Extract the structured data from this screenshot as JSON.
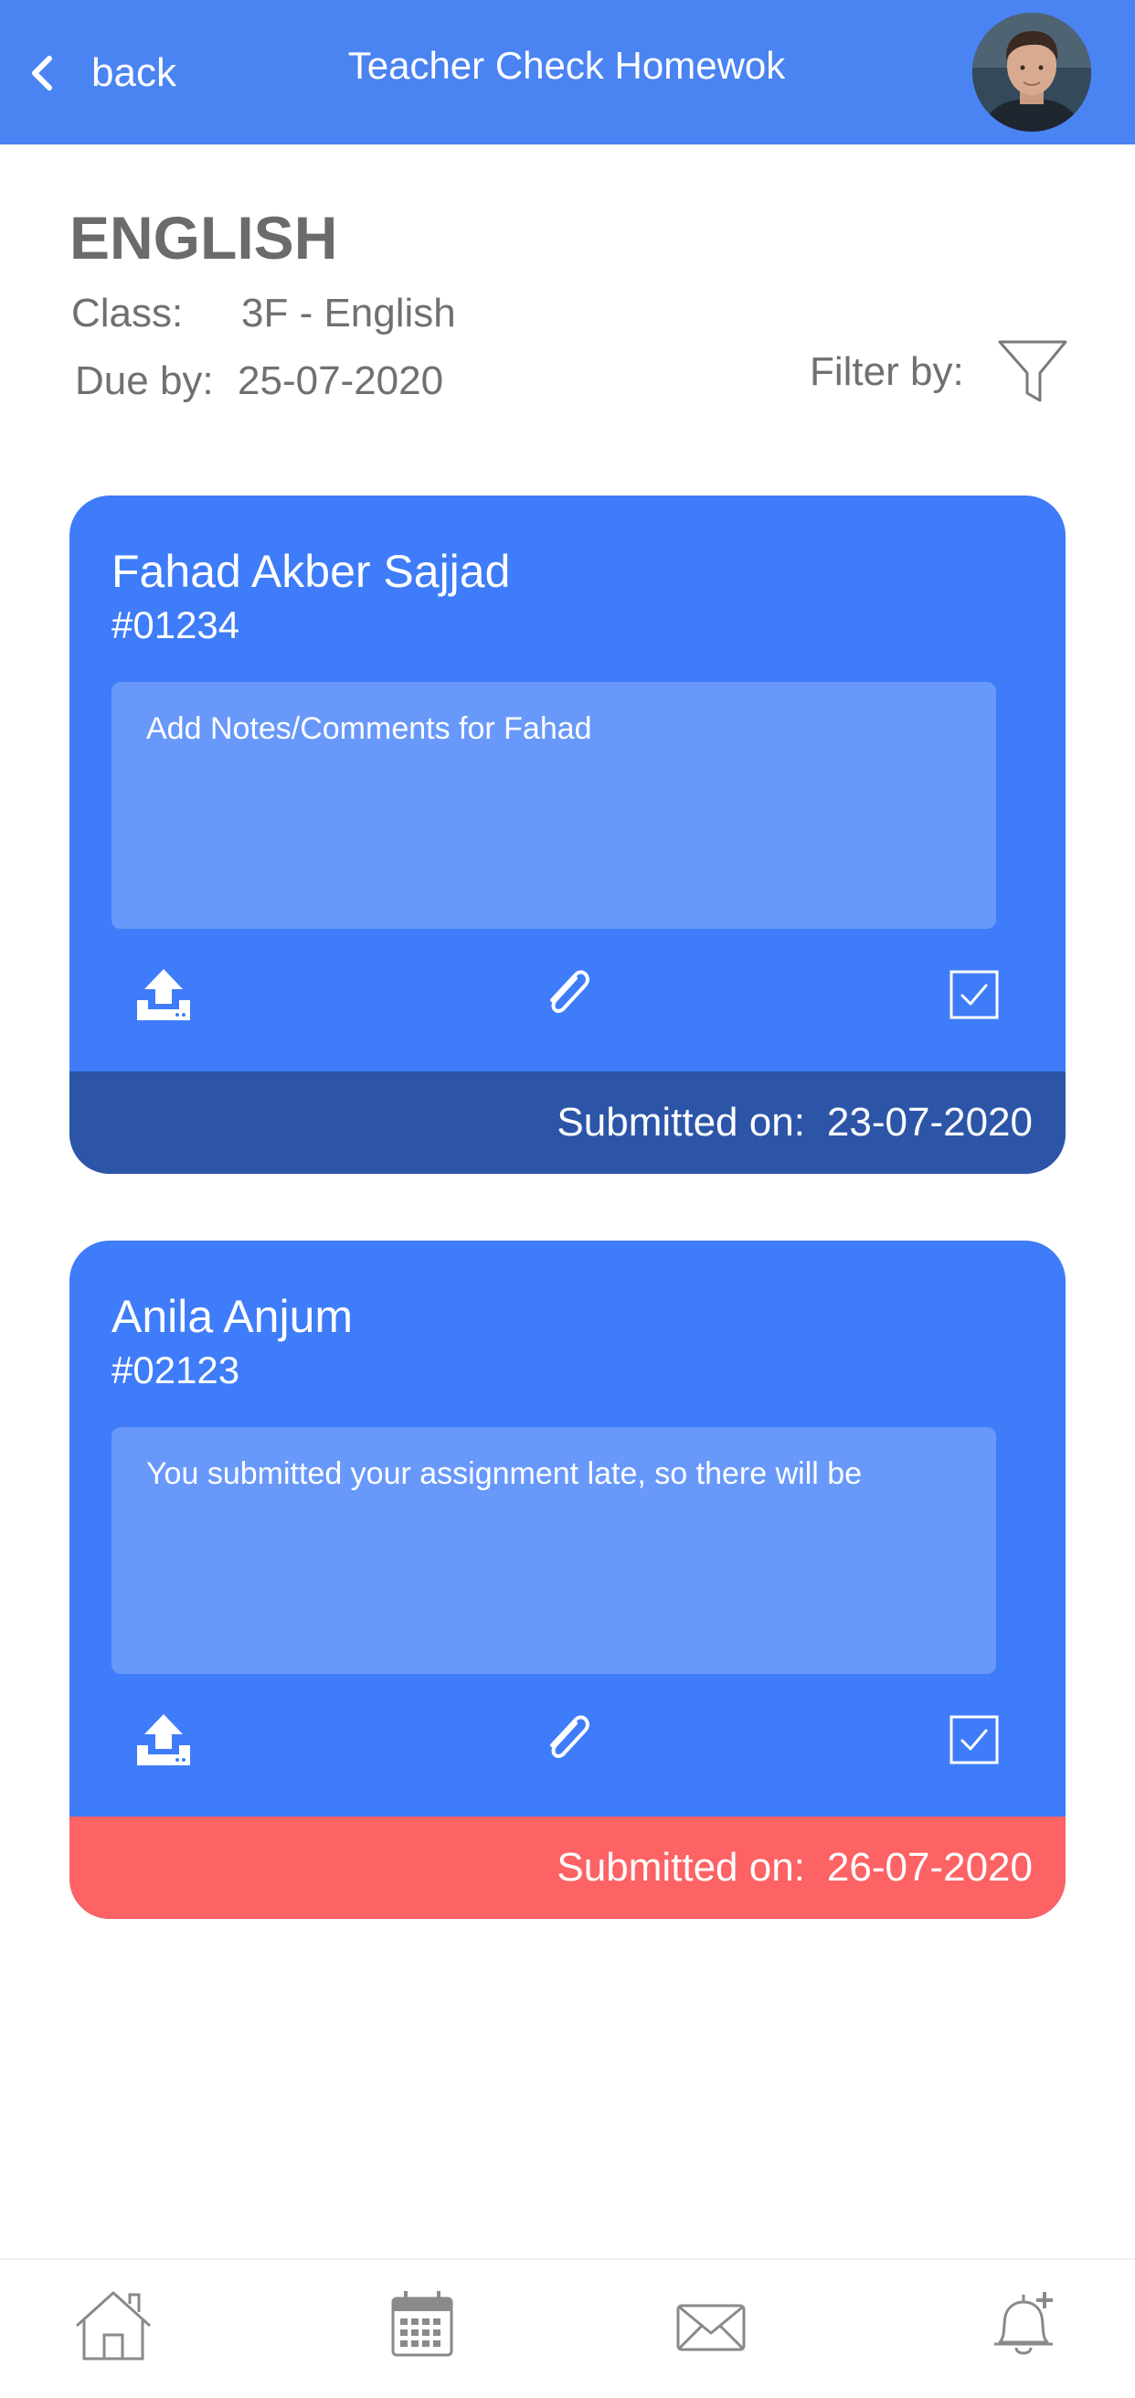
{
  "header": {
    "back_label": "back",
    "title": "Teacher Check Homewok",
    "color": "#4a83f2"
  },
  "homework": {
    "subject": "ENGLISH",
    "class_label": "Class:",
    "class_value": "3F - English",
    "due_label": "Due by:",
    "due_value": "25-07-2020",
    "filter_label": "Filter by:"
  },
  "submissions": [
    {
      "name": "Fahad Akber Sajjad",
      "id": "#01234",
      "note_placeholder": "Add Notes/Comments for Fahad",
      "submitted_label": "Submitted on:",
      "submitted_date": "23-07-2020",
      "status_color": "#2c55a8"
    },
    {
      "name": "Anila Anjum",
      "id": "#02123",
      "note_text": "You submitted your assignment late, so there will be",
      "submitted_label": "Submitted on:",
      "submitted_date": "26-07-2020",
      "status_color": "#fd6264"
    }
  ],
  "icons": {
    "card_actions": [
      "upload-icon",
      "paperclip-icon",
      "checkbox-icon"
    ],
    "bottom_nav": [
      "home-icon",
      "calendar-icon",
      "mail-icon",
      "notification-bell-icon"
    ]
  },
  "colors": {
    "card_blue": "#3e7cf9",
    "note_box": "#6899fa",
    "on_time_footer": "#2c55a8",
    "late_footer": "#fd6264"
  }
}
